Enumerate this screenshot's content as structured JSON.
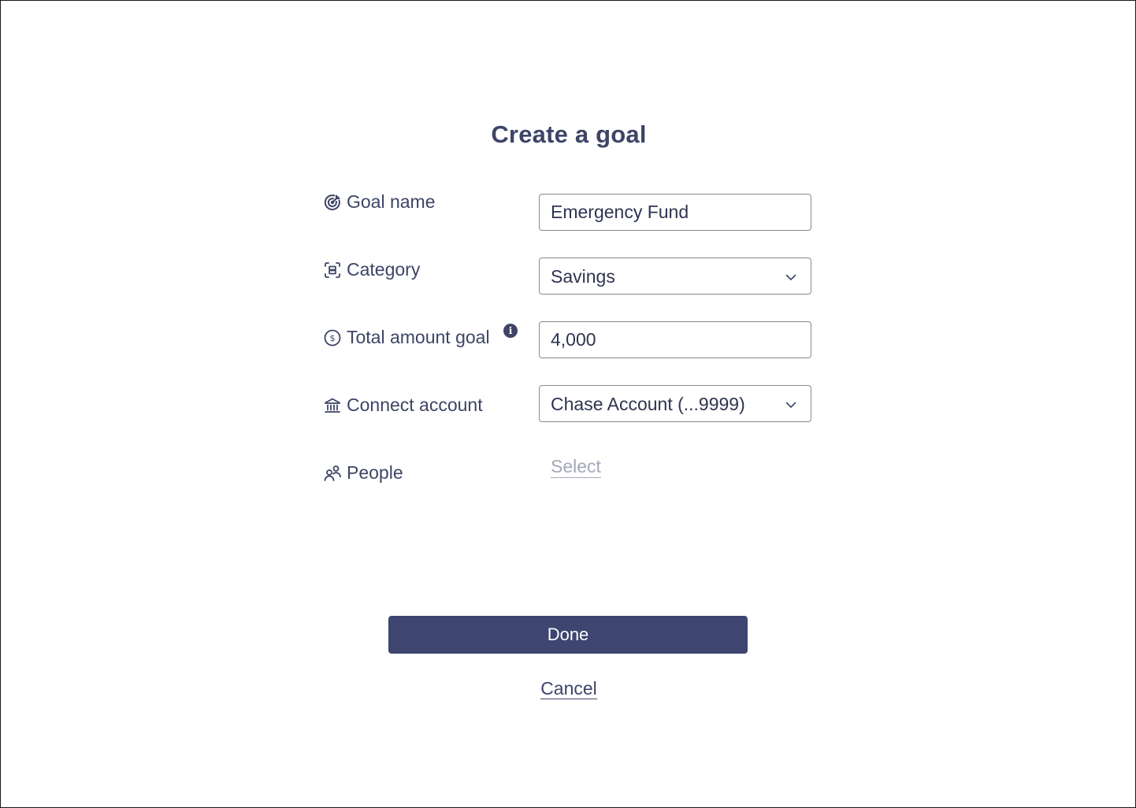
{
  "title": "Create a goal",
  "fields": {
    "goal_name": {
      "label": "Goal name",
      "value": "Emergency Fund",
      "icon": "target-icon"
    },
    "category": {
      "label": "Category",
      "value": "Savings",
      "icon": "category-scan-icon"
    },
    "total_amount": {
      "label": "Total amount goal",
      "value": "4,000",
      "icon": "dollar-circle-icon",
      "info_icon": "info-icon"
    },
    "connect_account": {
      "label": "Connect account",
      "value": "Chase Account (...9999)",
      "icon": "bank-icon"
    },
    "people": {
      "label": "People",
      "action": "Select",
      "icon": "people-icon"
    }
  },
  "actions": {
    "done": "Done",
    "cancel": "Cancel"
  },
  "colors": {
    "primary": "#3d4570",
    "text": "#3d4466",
    "muted": "#a6a8b8",
    "border": "#8a8a8f"
  }
}
